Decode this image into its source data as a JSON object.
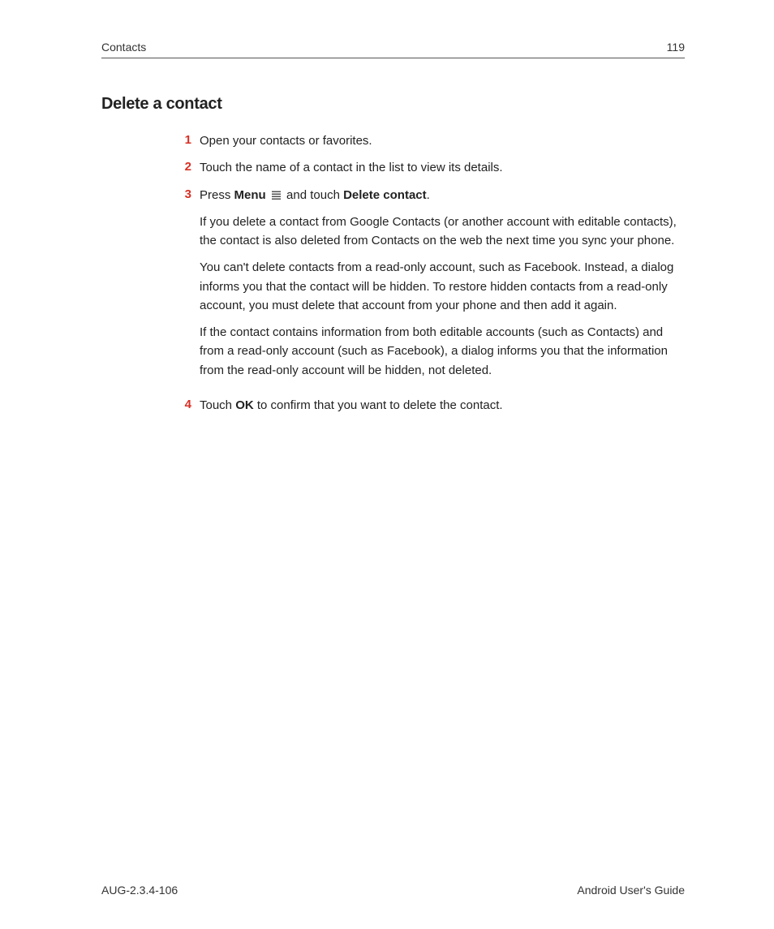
{
  "header": {
    "section": "Contacts",
    "pageNumber": "119"
  },
  "title": "Delete a contact",
  "steps": {
    "s1": {
      "num": "1",
      "text": "Open your contacts or favorites."
    },
    "s2": {
      "num": "2",
      "text": "Touch the name of a contact in the list to view its details."
    },
    "s3": {
      "num": "3",
      "pre": "Press ",
      "menu": "Menu",
      "mid": " and touch ",
      "action": "Delete contact",
      "post": ".",
      "p1": "If you delete a contact from Google Contacts (or another account with editable contacts), the contact is also deleted from Contacts on the web the next time you sync your phone.",
      "p2": "You can't delete contacts from a read-only account, such as Facebook. Instead, a dialog informs you that the contact will be hidden. To restore hidden contacts from a read-only account, you must delete that account from your phone and then add it again.",
      "p3": "If the contact contains information from both editable accounts (such as Contacts) and from a read-only account (such as Facebook), a dialog informs you that the information from the read-only account will be hidden, not deleted."
    },
    "s4": {
      "num": "4",
      "pre": "Touch ",
      "ok": "OK",
      "post": " to confirm that you want to delete the contact."
    }
  },
  "footer": {
    "left": "AUG-2.3.4-106",
    "right": "Android User's Guide"
  }
}
